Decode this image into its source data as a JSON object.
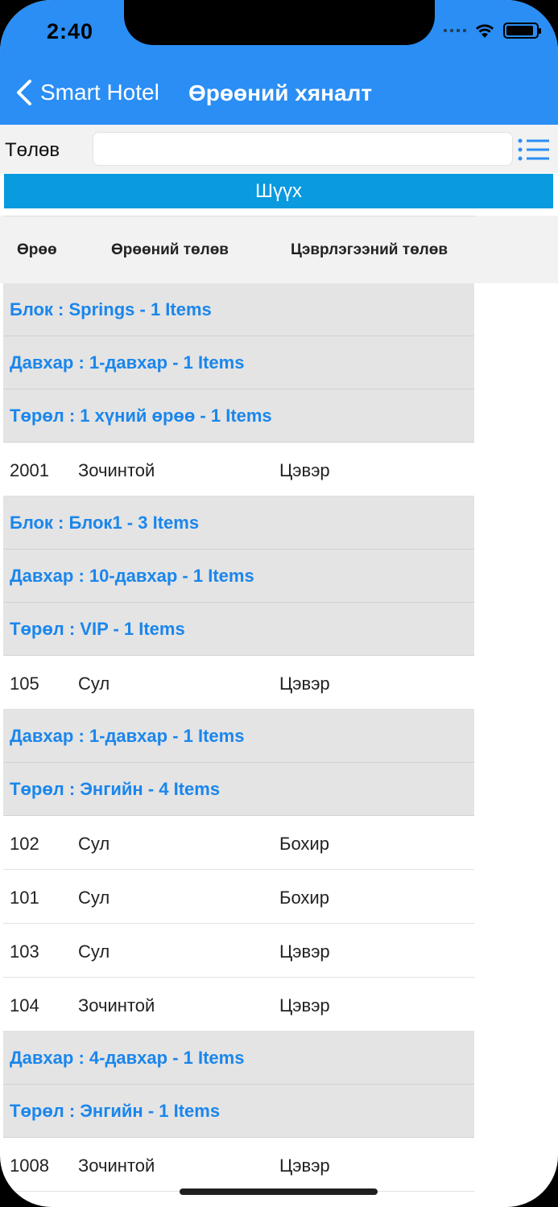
{
  "status_bar": {
    "time": "2:40"
  },
  "nav": {
    "back_label": "Smart Hotel",
    "title": "Өрөөний хяналт"
  },
  "filter": {
    "label": "Төлөв",
    "input_value": "",
    "search_label": "Шүүх"
  },
  "columns": [
    "Өрөө",
    "Өрөөний төлөв",
    "Цэврлэгээний төлөв"
  ],
  "list": [
    {
      "type": "group",
      "text": "Блок : Springs - 1 Items"
    },
    {
      "type": "group",
      "text": "Давхар : 1-давхар - 1 Items"
    },
    {
      "type": "group",
      "text": "Төрөл : 1 хүний өрөө - 1 Items"
    },
    {
      "type": "room",
      "room": "2001",
      "status": "Зочинтой",
      "clean": "Цэвэр"
    },
    {
      "type": "group",
      "text": "Блок : Блок1 - 3 Items"
    },
    {
      "type": "group",
      "text": "Давхар : 10-давхар - 1 Items"
    },
    {
      "type": "group",
      "text": "Төрөл : VIP - 1 Items"
    },
    {
      "type": "room",
      "room": "105",
      "status": "Сул",
      "clean": "Цэвэр"
    },
    {
      "type": "group",
      "text": "Давхар : 1-давхар - 1 Items"
    },
    {
      "type": "group",
      "text": "Төрөл : Энгийн - 4 Items"
    },
    {
      "type": "room",
      "room": "102",
      "status": "Сул",
      "clean": "Бохир"
    },
    {
      "type": "room",
      "room": "101",
      "status": "Сул",
      "clean": "Бохир"
    },
    {
      "type": "room",
      "room": "103",
      "status": "Сул",
      "clean": "Цэвэр"
    },
    {
      "type": "room",
      "room": "104",
      "status": "Зочинтой",
      "clean": "Цэвэр"
    },
    {
      "type": "group",
      "text": "Давхар : 4-давхар - 1 Items"
    },
    {
      "type": "group",
      "text": "Төрөл : Энгийн - 1 Items"
    },
    {
      "type": "room",
      "room": "1008",
      "status": "Зочинтой",
      "clean": "Цэвэр"
    }
  ],
  "colors": {
    "header": "#2a8ef4",
    "search_button": "#0a9ade",
    "group_text": "#1a86ec",
    "group_bg": "#e4e4e4"
  },
  "icons": {
    "back": "chevron-left-icon",
    "list": "list-icon",
    "wifi": "wifi-icon",
    "battery": "battery-icon",
    "signal": "signal-icon"
  }
}
